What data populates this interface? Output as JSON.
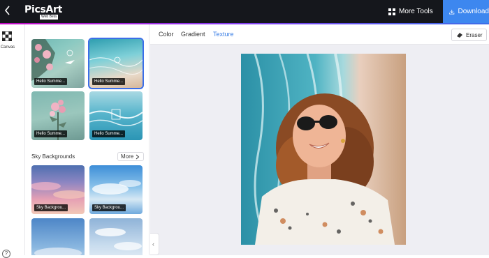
{
  "app": {
    "logo_text": "PicsArt",
    "logo_tag": "Web Beta"
  },
  "topbar": {
    "more_tools_label": "More Tools",
    "download_label": "Download"
  },
  "rail": {
    "canvas_label": "Canvas",
    "help_label": "?"
  },
  "panel": {
    "textures": [
      {
        "caption": "Hello Summe..."
      },
      {
        "caption": "Hello Summe..."
      },
      {
        "caption": "Hello Summe..."
      },
      {
        "caption": "Hello Summe..."
      }
    ],
    "sky_section": {
      "title": "Sky Backgrounds",
      "more_label": "More",
      "items": [
        {
          "caption": "Sky Backgrou..."
        },
        {
          "caption": "Sky Backgrou..."
        }
      ]
    }
  },
  "main": {
    "tabs": [
      {
        "label": "Color"
      },
      {
        "label": "Gradient"
      },
      {
        "label": "Texture"
      }
    ],
    "active_tab": "Texture",
    "eraser_label": "Eraser"
  },
  "colors": {
    "topbar_bg": "#15171c",
    "download_bg": "#3d87ef",
    "accent_active": "#3b7fe6",
    "canvas_bg": "#eeeef3"
  }
}
